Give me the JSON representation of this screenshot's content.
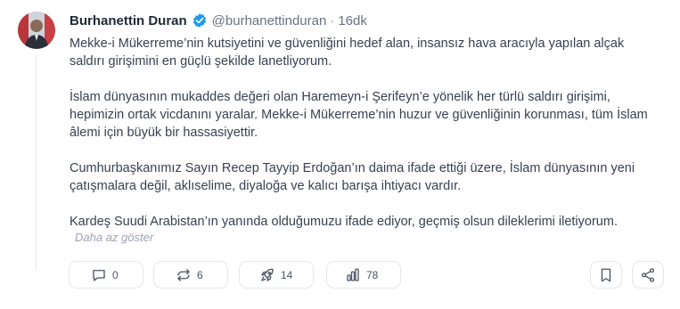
{
  "post": {
    "author": {
      "name": "Burhanettin Duran",
      "handle": "@burhanettinduran",
      "verified": true,
      "avatar_icon": "profile-photo"
    },
    "separator": "·",
    "time": "16dk",
    "paragraphs": [
      "Mekke-i Mükerreme’nin kutsiyetini ve güvenliğini hedef alan, insansız hava aracıyla yapılan alçak\nsaldırı girişimini en güçlü şekilde lanetliyorum.",
      "İslam dünyasının mukaddes değeri olan Haremeyn-i Şerifeyn’e yönelik her türlü saldırı girişimi,\nhepimizin ortak vicdanını yaralar. Mekke-i Mükerreme’nin huzur ve güvenliğinin korunması, tüm İslam\nâlemi için büyük bir hassasiyettir.",
      "Cumhurbaşkanımız Sayın Recep Tayyip Erdoğan’ın daima ifade ettiği üzere, İslam dünyasının yeni\nçatışmalara değil, aklıselime, diyaloğa ve kalıcı barışa ihtiyacı vardır.",
      "Kardeş Suudi Arabistan’ın yanında olduğumuzu ifade ediyor, geçmiş olsun dileklerimi iletiyorum."
    ],
    "show_less_label": "Daha az göster"
  },
  "actions": {
    "reply": {
      "icon": "comment-icon",
      "count": "0"
    },
    "repost": {
      "icon": "repost-icon",
      "count": "6"
    },
    "boost": {
      "icon": "rocket-icon",
      "count": "14"
    },
    "views": {
      "icon": "bar-chart-icon",
      "count": "78"
    },
    "save": {
      "icon": "bookmark-icon"
    },
    "share": {
      "icon": "share-icon"
    }
  },
  "colors": {
    "verified_badge": "#1d9bf0",
    "text": "#374151",
    "muted": "#6b7280",
    "border": "#e5e7eb"
  }
}
